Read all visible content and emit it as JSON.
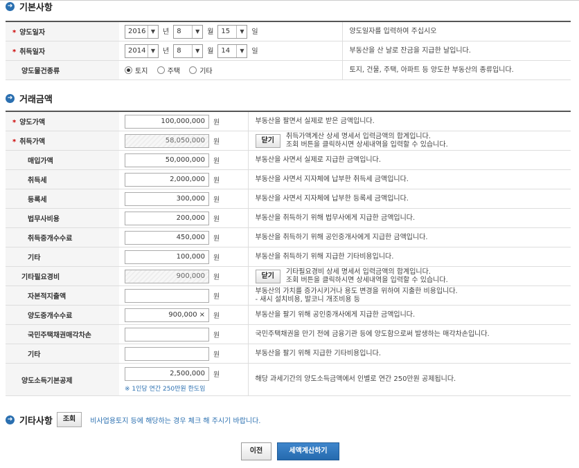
{
  "section_basic": {
    "title": "기본사항",
    "transfer_date": {
      "label": "양도일자",
      "year": "2016",
      "year_unit": "년",
      "month": "8",
      "month_unit": "월",
      "day": "15",
      "day_unit": "일",
      "desc": "양도일자를 입력하여 주십시오"
    },
    "acquire_date": {
      "label": "취득일자",
      "year": "2014",
      "year_unit": "년",
      "month": "8",
      "month_unit": "월",
      "day": "14",
      "day_unit": "일",
      "desc": "부동산을 산 날로 잔금을 지급한 날입니다."
    },
    "property_type": {
      "label": "양도물건종류",
      "options": [
        "토지",
        "주택",
        "기타"
      ],
      "selected": "토지",
      "desc": "토지, 건물, 주택, 아파트 등 양도한 부동산의 종류입니다."
    }
  },
  "section_amount": {
    "title": "거래금액",
    "unit": "원",
    "close_label": "닫기",
    "rows": [
      {
        "label": "양도가액",
        "value": "100,000,000",
        "desc": "부동산을 팔면서 실제로 받은 금액입니다."
      },
      {
        "label": "취득가액",
        "value": "58,050,000",
        "desc": "취득가액계산 상세 명세서 입력금액의 합계입니다.",
        "desc2": "조회 버튼을 클릭하시면 상세내역을 입력할 수 있습니다."
      },
      {
        "label": "매입가액",
        "value": "50,000,000",
        "desc": "부동산을 사면서 실제로 지급한 금액입니다."
      },
      {
        "label": "취득세",
        "value": "2,000,000",
        "desc": "부동산을 사면서 지자체에 납부한 취득세 금액입니다."
      },
      {
        "label": "등록세",
        "value": "300,000",
        "desc": "부동산을 사면서 지자체에 납부한 등록세 금액입니다."
      },
      {
        "label": "법무사비용",
        "value": "200,000",
        "desc": "부동산을 취득하기 위해 법무사에게 지급한 금액입니다."
      },
      {
        "label": "취득중개수수료",
        "value": "450,000",
        "desc": "부동산을 취득하기 위해 공인중개사에게 지급한 금액입니다."
      },
      {
        "label": "기타",
        "value": "100,000",
        "desc": "부동산을 취득하기 위해 지급한 기타비용입니다."
      },
      {
        "label": "기타필요경비",
        "value": "900,000",
        "desc": "기타필요경비 상세 명세서 입력금액의 합계입니다.",
        "desc2": "조회 버튼을 클릭하시면 상세내역을 입력할 수 있습니다."
      },
      {
        "label": "자본적지출액",
        "value": "",
        "desc": "부동산의 가치를 증가시키거나 용도 변경을 위하여 지출한 비용입니다.",
        "desc2": "- 새시 설치비용, 발코니 개조비용 등"
      },
      {
        "label": "양도중개수수료",
        "value": "900,000",
        "clear": "×",
        "desc": "부동산을 팔기 위해 공인중개사에게 지급한 금액입니다."
      },
      {
        "label": "국민주택채권매각차손",
        "value": "",
        "desc": "국민주택채권을 만기 전에 금융기관 등에 양도함으로써 발생하는 매각차손입니다."
      },
      {
        "label": "기타",
        "value": "",
        "desc": "부동산을 팔기 위해 지급한 기타비용입니다."
      },
      {
        "label": "양도소득기본공제",
        "value": "2,500,000",
        "note": "※ 1인당 연간 250만원 한도임",
        "desc": "해당 과세기간의 양도소득금액에서 인별로 연간 250만원 공제됩니다."
      }
    ]
  },
  "section_etc": {
    "title": "기타사항",
    "lookup_label": "조회",
    "note": "비사업용토지 등에 해당하는 경우 체크 해 주시기 바랍니다."
  },
  "footer": {
    "prev_label": "이전",
    "calc_label": "세액계산하기"
  },
  "colors": {
    "accent": "#2a6fb0",
    "required": "#cc0000"
  }
}
